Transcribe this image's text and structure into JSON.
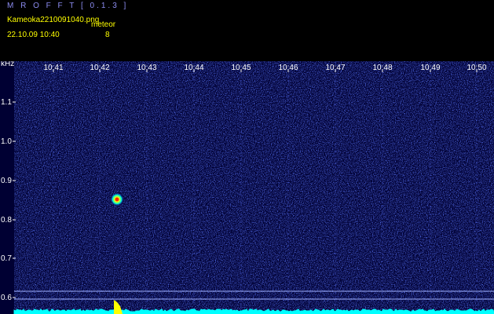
{
  "app": {
    "title": "M R O F F T [ 0.1.3 ]",
    "filename": "Kameoka2210091040.png",
    "label": "meteor",
    "datetime": "22.10.09  10:40",
    "count": "8"
  },
  "axis": {
    "unit": "kHz",
    "y_ticks": [
      "1.1",
      "1.0",
      "0.9",
      "0.8",
      "0.7",
      "0.6"
    ],
    "x_ticks": [
      "10:41",
      "10:42",
      "10:43",
      "10:44",
      "10:45",
      "10:46",
      "10:47",
      "10:48",
      "10:49",
      "10:50"
    ]
  },
  "colors": {
    "background": "#000033",
    "noise": "#1a2ad6",
    "ticks": "#ffffff",
    "title": "#8c8cf0",
    "text": "#ffff00",
    "baseline": "#00ffff"
  }
}
